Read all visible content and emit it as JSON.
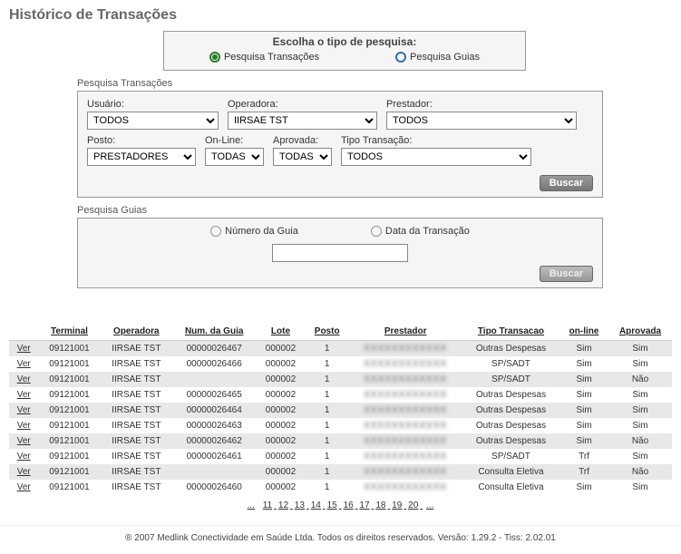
{
  "pageTitle": "Histórico de Transações",
  "searchType": {
    "heading": "Escolha o tipo de pesquisa:",
    "opt1": "Pesquisa Transações",
    "opt2": "Pesquisa Guias"
  },
  "transLabel": "Pesquisa Transações",
  "transForm": {
    "usuarioLabel": "Usuário:",
    "usuarioValue": "TODOS",
    "operadoraLabel": "Operadora:",
    "operadoraValue": "IIRSAE TST",
    "prestadorLabel": "Prestador:",
    "prestadorValue": "TODOS",
    "postoLabel": "Posto:",
    "postoValue": "PRESTADORES",
    "onlineLabel": "On-Line:",
    "onlineValue": "TODAS",
    "aprovadaLabel": "Aprovada:",
    "aprovadaValue": "TODAS",
    "tipoLabel": "Tipo Transação:",
    "tipoValue": "TODOS",
    "buscar": "Buscar"
  },
  "guiaLabel": "Pesquisa Guias",
  "guiaForm": {
    "optNum": "Número da Guia",
    "optData": "Data da Transação",
    "buscar": "Buscar"
  },
  "table": {
    "verLabel": "Ver",
    "headers": {
      "terminal": "Terminal",
      "operadora": "Operadora",
      "numGuia": "Num. da Guia",
      "lote": "Lote",
      "posto": "Posto",
      "prestador": "Prestador",
      "tipoTrans": "Tipo Transacao",
      "online": "on-line",
      "aprovada": "Aprovada"
    },
    "rows": [
      {
        "terminal": "09121001",
        "operadora": "IIRSAE TST",
        "numGuia": "00000026467",
        "lote": "000002",
        "posto": "1",
        "tipo": "Outras Despesas",
        "online": "Sim",
        "aprov": "Sim"
      },
      {
        "terminal": "09121001",
        "operadora": "IIRSAE TST",
        "numGuia": "00000026466",
        "lote": "000002",
        "posto": "1",
        "tipo": "SP/SADT",
        "online": "Sim",
        "aprov": "Sim"
      },
      {
        "terminal": "09121001",
        "operadora": "IIRSAE TST",
        "numGuia": "",
        "lote": "000002",
        "posto": "1",
        "tipo": "SP/SADT",
        "online": "Sim",
        "aprov": "Não"
      },
      {
        "terminal": "09121001",
        "operadora": "IIRSAE TST",
        "numGuia": "00000026465",
        "lote": "000002",
        "posto": "1",
        "tipo": "Outras Despesas",
        "online": "Sim",
        "aprov": "Sim"
      },
      {
        "terminal": "09121001",
        "operadora": "IIRSAE TST",
        "numGuia": "00000026464",
        "lote": "000002",
        "posto": "1",
        "tipo": "Outras Despesas",
        "online": "Sim",
        "aprov": "Sim"
      },
      {
        "terminal": "09121001",
        "operadora": "IIRSAE TST",
        "numGuia": "00000026463",
        "lote": "000002",
        "posto": "1",
        "tipo": "Outras Despesas",
        "online": "Sim",
        "aprov": "Sim"
      },
      {
        "terminal": "09121001",
        "operadora": "IIRSAE TST",
        "numGuia": "00000026462",
        "lote": "000002",
        "posto": "1",
        "tipo": "Outras Despesas",
        "online": "Sim",
        "aprov": "Não"
      },
      {
        "terminal": "09121001",
        "operadora": "IIRSAE TST",
        "numGuia": "00000026461",
        "lote": "000002",
        "posto": "1",
        "tipo": "SP/SADT",
        "online": "Trf",
        "aprov": "Sim"
      },
      {
        "terminal": "09121001",
        "operadora": "IIRSAE TST",
        "numGuia": "",
        "lote": "000002",
        "posto": "1",
        "tipo": "Consulta Eletiva",
        "online": "Trf",
        "aprov": "Não"
      },
      {
        "terminal": "09121001",
        "operadora": "IIRSAE TST",
        "numGuia": "00000026460",
        "lote": "000002",
        "posto": "1",
        "tipo": "Consulta Eletiva",
        "online": "Sim",
        "aprov": "Sim"
      }
    ]
  },
  "pager": {
    "prefix": "...",
    "pages": [
      "11",
      "12",
      "13",
      "14",
      "15",
      "16",
      "17",
      "18",
      "19",
      "20"
    ],
    "current": "11",
    "suffix": "..."
  },
  "footer": {
    "copyright": "® 2007  Medlink Conectividade em Saúde Ltda.   Todos os direitos reservados.   Versão: 1.29.2 - Tiss: 2.02.01"
  }
}
